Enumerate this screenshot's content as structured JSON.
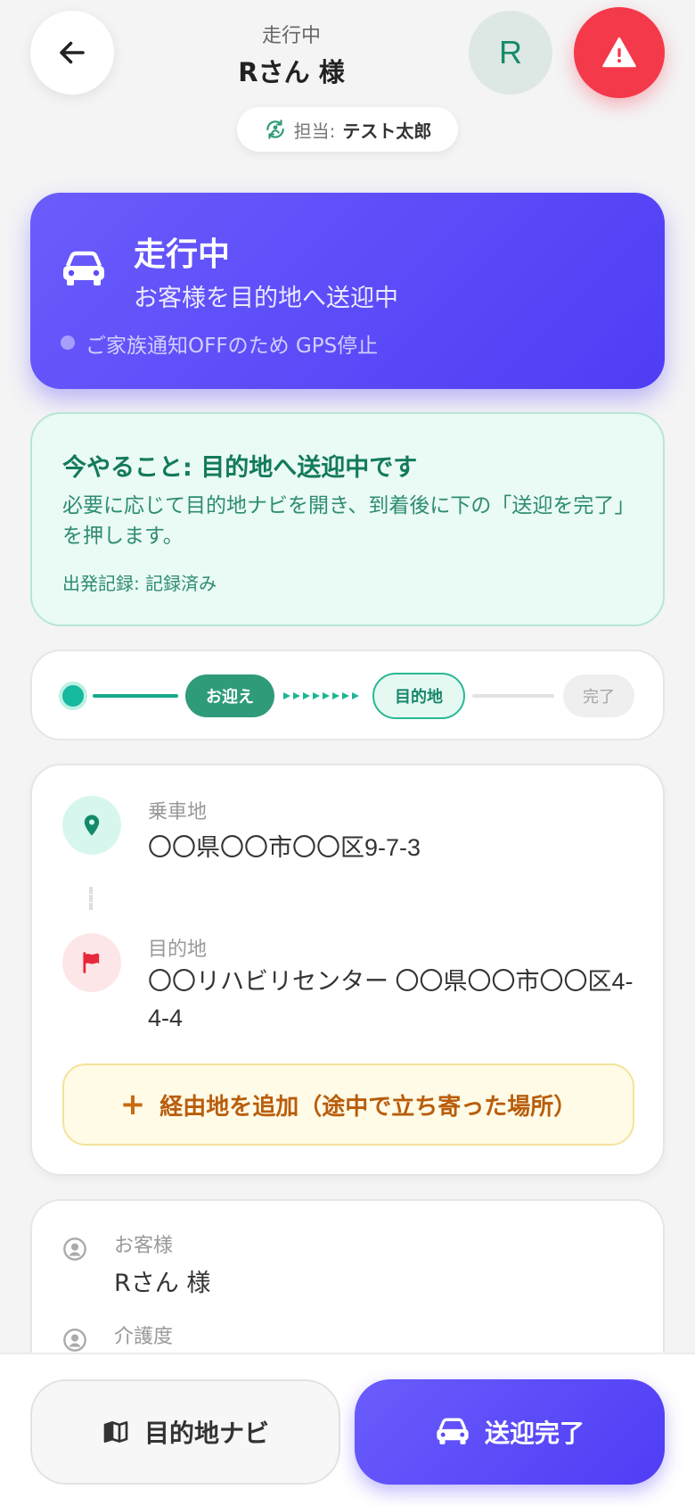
{
  "header": {
    "status": "走行中",
    "customer_name": "Rさん 様",
    "avatar_initial": "R",
    "staff_label": "担当:",
    "staff_name": "テスト太郎"
  },
  "status_card": {
    "title": "走行中",
    "subtitle": "お客様を目的地へ送迎中",
    "gps_note": "ご家族通知OFFのため GPS停止"
  },
  "todo": {
    "title": "今やること: 目的地へ送迎中です",
    "body": "必要に応じて目的地ナビを開き、到着後に下の「送迎を完了」を押します。",
    "record": "出発記録: 記録済み"
  },
  "progress": {
    "steps": [
      "お迎え",
      "目的地",
      "完了"
    ]
  },
  "route": {
    "pickup_label": "乗車地",
    "pickup_address": "〇〇県〇〇市〇〇区9-7-3",
    "dest_label": "目的地",
    "dest_address": "〇〇リハビリセンター 〇〇県〇〇市〇〇区4-4-4",
    "add_waypoint": "経由地を追加（途中で立ち寄った場所）"
  },
  "info": {
    "customer_label": "お客様",
    "customer_value": "Rさん 様",
    "care_label": "介護度"
  },
  "bottom": {
    "nav_label": "目的地ナビ",
    "done_label": "送迎完了"
  },
  "colors": {
    "accent": "#5b4cf8",
    "sos": "#f4394a",
    "teal": "#2f9b7a",
    "todo_bg": "#eafaf4",
    "waypoint_text": "#b95d0c"
  },
  "icons": {
    "back": "arrow-left-icon",
    "sos": "warning-triangle-icon",
    "staff": "staff-sync-icon",
    "car": "car-icon",
    "pickup": "map-pin-icon",
    "destination": "flag-icon",
    "plus": "plus-icon",
    "person": "person-icon",
    "map": "map-icon"
  }
}
